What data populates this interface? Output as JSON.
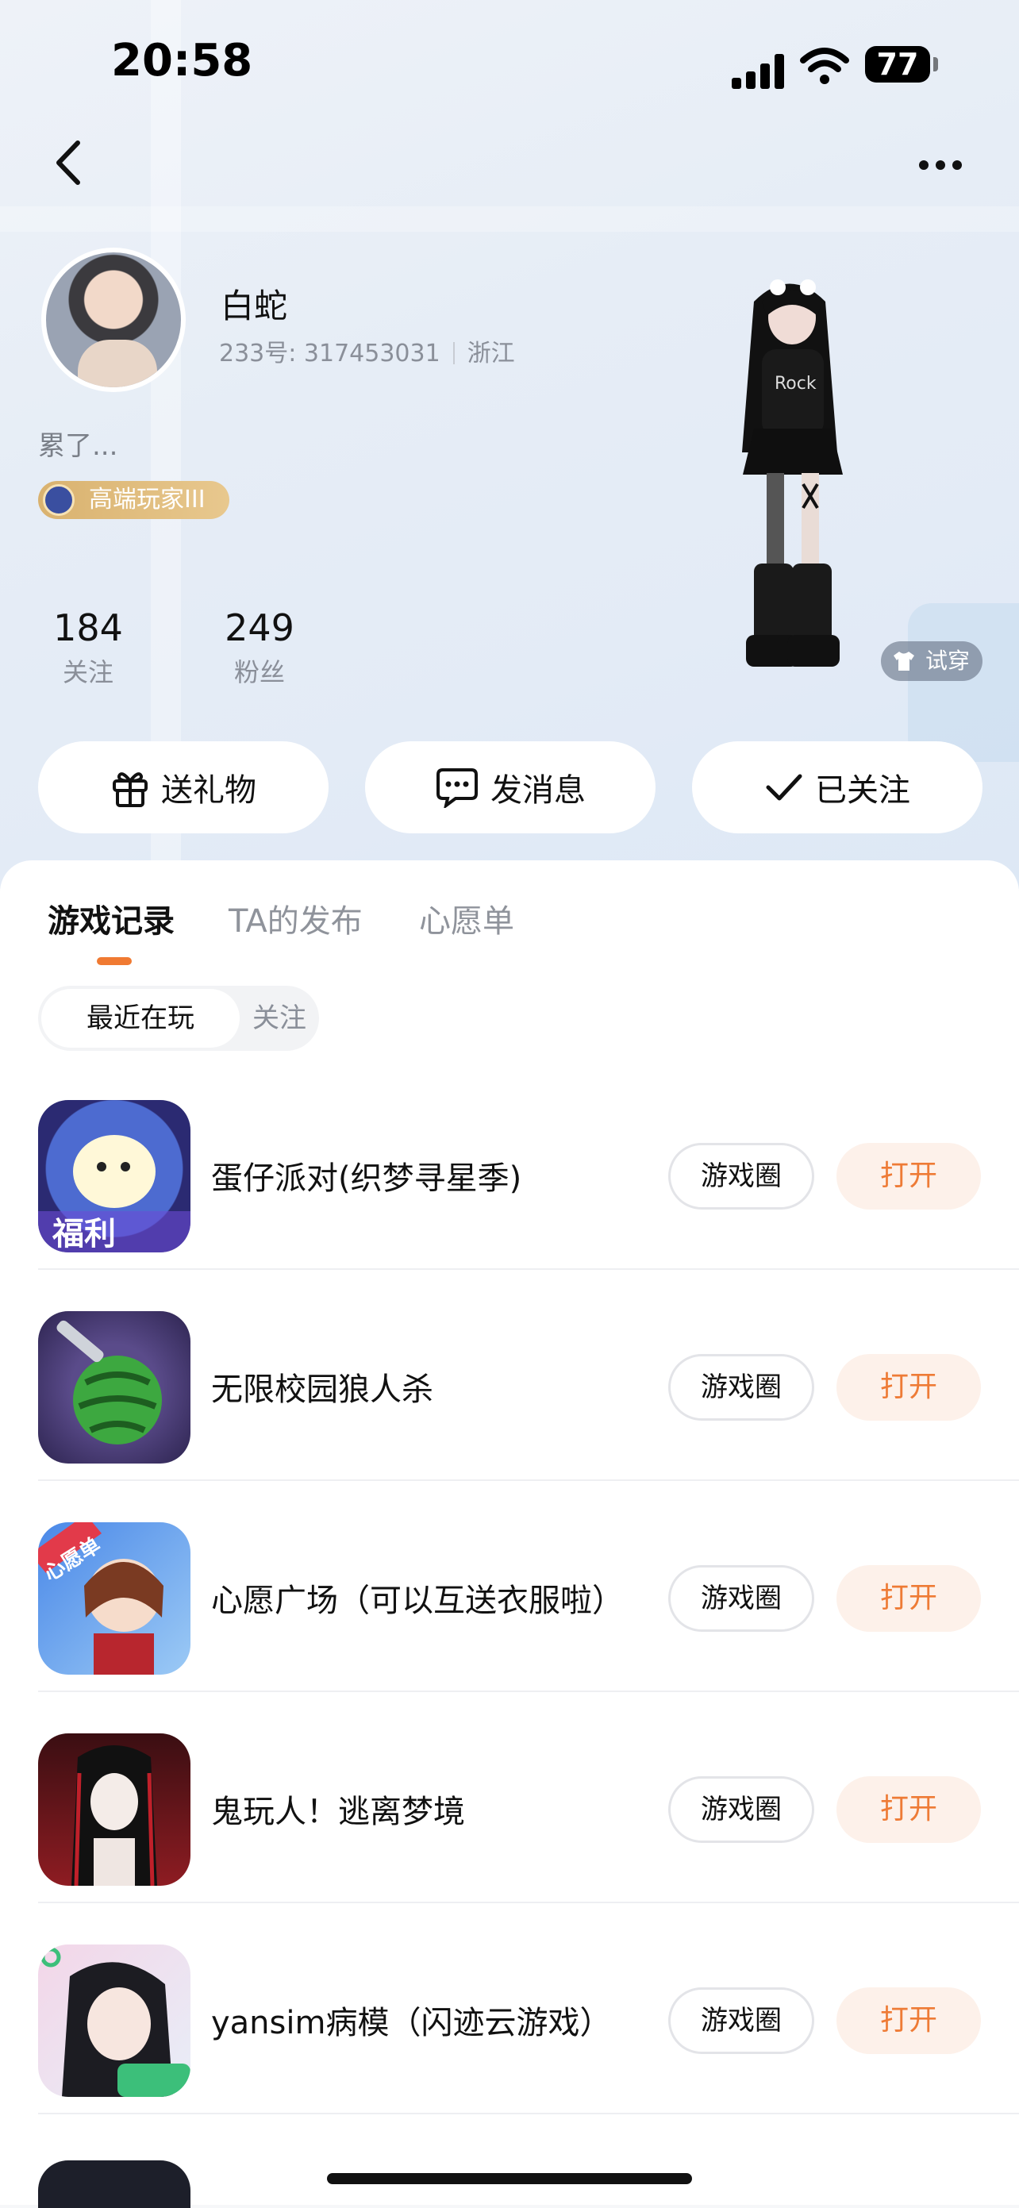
{
  "status_bar": {
    "time": "20:58",
    "battery": "77"
  },
  "profile": {
    "name": "白蛇",
    "id_label": "233号: 317453031",
    "location": "浙江",
    "bio": "累了...",
    "badge": "高端玩家III",
    "stats": [
      {
        "value": "184",
        "label": "关注"
      },
      {
        "value": "249",
        "label": "粉丝"
      }
    ],
    "try_on": "试穿"
  },
  "actions": {
    "gift": "送礼物",
    "message": "发消息",
    "following": "已关注"
  },
  "tabs": [
    "游戏记录",
    "TA的发布",
    "心愿单"
  ],
  "segments": {
    "recent": "最近在玩",
    "follow": "关注"
  },
  "games": [
    {
      "name": "蛋仔派对(织梦寻星季)",
      "circle": "游戏圈",
      "open": "打开"
    },
    {
      "name": "无限校园狼人杀",
      "circle": "游戏圈",
      "open": "打开"
    },
    {
      "name": "心愿广场（可以互送衣服啦）",
      "circle": "游戏圈",
      "open": "打开"
    },
    {
      "name": "鬼玩人！逃离梦境",
      "circle": "游戏圈",
      "open": "打开"
    },
    {
      "name": "yansim病模（闪迹云游戏）",
      "circle": "游戏圈",
      "open": "打开"
    }
  ],
  "icon_text": {
    "fuli": "福利",
    "wish": "心愿单"
  },
  "colors": {
    "accent": "#f07a32",
    "open_bg": "#fdf1ea",
    "badge": "#d9b26f"
  }
}
